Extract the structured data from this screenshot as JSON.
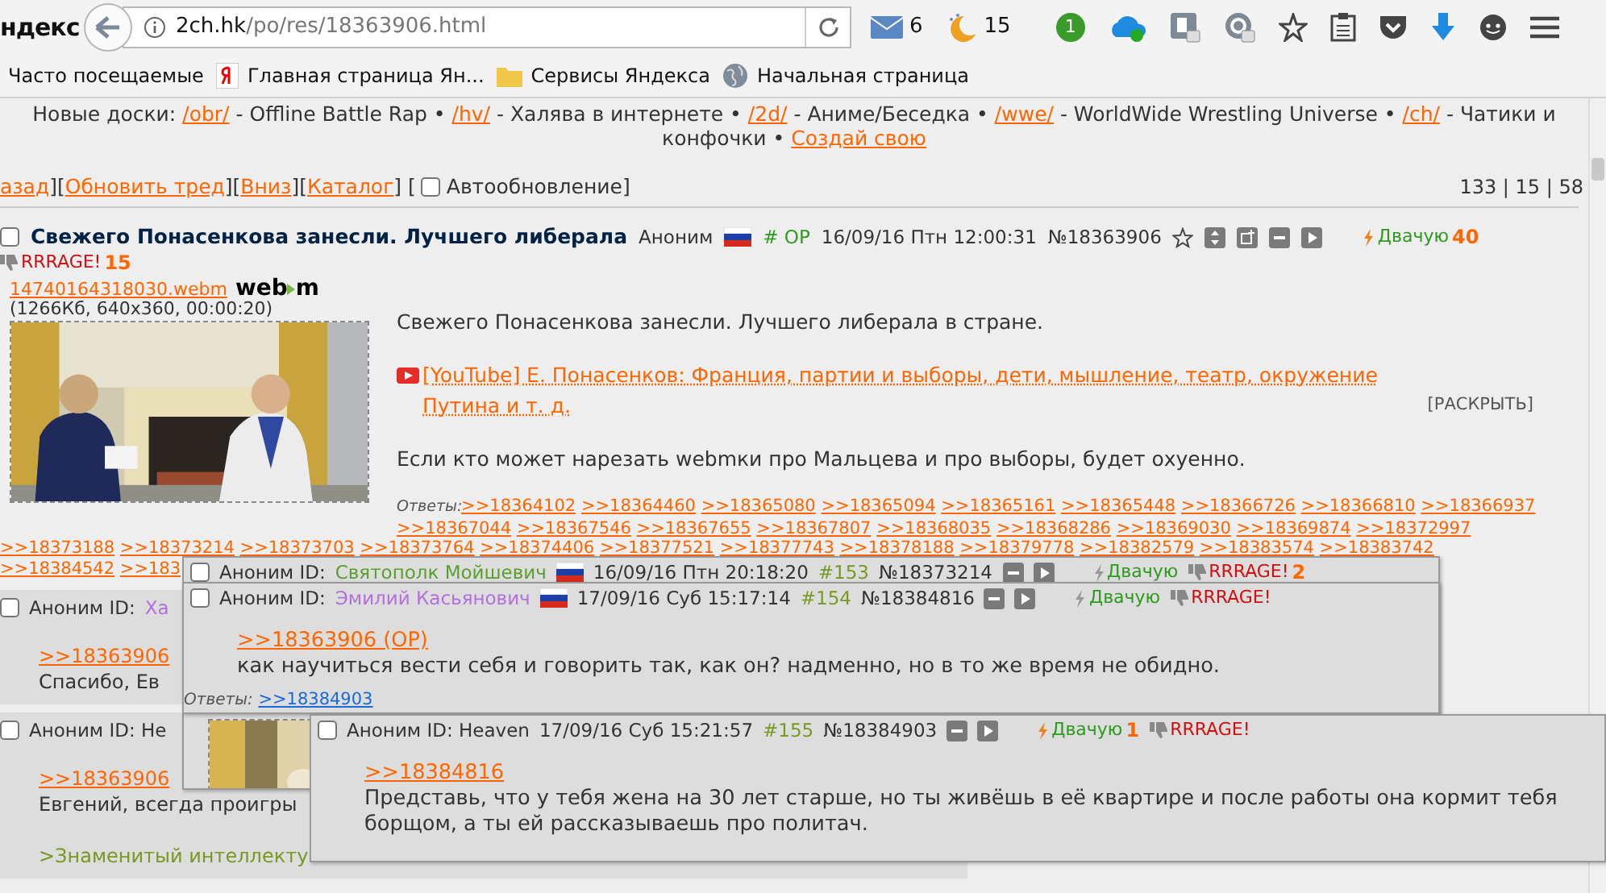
{
  "browser": {
    "logo": "ндекс",
    "url_host": "2ch.hk",
    "url_path": "/po/res/18363906.html",
    "toolbar": [
      {
        "kind": "mail",
        "count": "6"
      },
      {
        "kind": "moon",
        "count": "15"
      },
      {
        "kind": "badge",
        "count": "1"
      },
      {
        "kind": "cloud"
      },
      {
        "kind": "b-ext"
      },
      {
        "kind": "g-ext"
      },
      {
        "kind": "star"
      },
      {
        "kind": "clipboard"
      },
      {
        "kind": "pocket"
      },
      {
        "kind": "download"
      },
      {
        "kind": "chat"
      },
      {
        "kind": "menu"
      }
    ],
    "bookmarks": [
      {
        "kind": "plain",
        "label": "Часто посещаемые"
      },
      {
        "kind": "yandex",
        "label": "Главная страница Ян..."
      },
      {
        "kind": "folder",
        "label": "Сервисы Яндекса"
      },
      {
        "kind": "globe",
        "label": "Начальная страница"
      }
    ]
  },
  "board_nav": [
    {
      "kind": "text",
      "text": "Новые доски:"
    },
    {
      "kind": "link",
      "text": "/obr/"
    },
    {
      "kind": "text",
      "text": "- Offline Battle Rap •"
    },
    {
      "kind": "link",
      "text": "/hv/"
    },
    {
      "kind": "text",
      "text": "- Халява в интернете •"
    },
    {
      "kind": "link",
      "text": "/2d/"
    },
    {
      "kind": "text",
      "text": "- Аниме/Беседка •"
    },
    {
      "kind": "link",
      "text": "/wwe/"
    },
    {
      "kind": "text",
      "text": "- WorldWide Wrestling Universe •"
    },
    {
      "kind": "link",
      "text": "/ch/"
    },
    {
      "kind": "text",
      "text": "- Чатики и конфочки •"
    },
    {
      "kind": "link",
      "text": "Создай свою"
    }
  ],
  "thread_nav": [
    {
      "kind": "link",
      "text": "азад"
    },
    {
      "kind": "text",
      "text": "]["
    },
    {
      "kind": "link",
      "text": "Обновить тред"
    },
    {
      "kind": "text",
      "text": "]["
    },
    {
      "kind": "link",
      "text": "Вниз"
    },
    {
      "kind": "text",
      "text": "]["
    },
    {
      "kind": "link",
      "text": "Каталог"
    },
    {
      "kind": "text",
      "text": "] ["
    },
    {
      "kind": "checkbox",
      "text": "Автообновление",
      "checked": false
    },
    {
      "kind": "text",
      "text": "]"
    }
  ],
  "counts": "133 | 15 | 58",
  "op": {
    "checked": false,
    "subject": "Свежего Понасенкова занесли. Лучшего либерала",
    "name": "Аноним",
    "flag": {
      "kind": "ru"
    },
    "op_mark": "# OP",
    "date": "16/09/16 Птн 12:00:31",
    "number": "№18363906",
    "buttons": [
      {
        "kind": "star"
      },
      {
        "kind": "updown"
      },
      {
        "kind": "window"
      },
      {
        "kind": "hide"
      },
      {
        "kind": "play"
      }
    ],
    "like": {
      "label": "Двачую",
      "count": "40"
    },
    "dislike": {
      "label": "RRRAGE!",
      "count": "15"
    },
    "file": {
      "name": "14740164318030.webm",
      "logo": [
        "web",
        "m"
      ],
      "info": "(1266Кб, 640x360, 00:00:20)"
    },
    "body": [
      {
        "kind": "text",
        "text": "Свежего Понасенкова занесли. Лучшего либерала в стране."
      },
      {
        "kind": "video",
        "text": "[YouTube] Е. Понасенков: Франция, партии и выборы, дети, мышление, театр, окружение Путина и т. д.",
        "expand": "[РАСКРЫТЬ]"
      },
      {
        "kind": "text",
        "text": "Если кто может нарезать webmки про Мальцева и про выборы, будет охуенно."
      }
    ],
    "replies_label": "Ответы:",
    "replies": [
      ">>18364102",
      ">>18364460",
      ">>18365080",
      ">>18365094",
      ">>18365161",
      ">>18365448",
      ">>18366726",
      ">>18366810",
      ">>18366937",
      ">>18367044",
      ">>18367546",
      ">>18367655",
      ">>18367807",
      ">>18368035",
      ">>18368286",
      ">>18369030",
      ">>18369874",
      ">>18372997",
      ">>18373188",
      ">>18373214",
      ">>18373703",
      ">>18373764",
      ">>18374406",
      ">>18377521",
      ">>18377743",
      ">>18378188",
      ">>18379778",
      ">>18382579",
      ">>18383574",
      ">>18383742",
      ">>18384542",
      ">>183"
    ]
  },
  "posts": [
    {
      "checked": false,
      "name": "Аноним ID:",
      "id": {
        "text": "Ха",
        "color": "#b36fe0"
      },
      "body": [
        {
          "kind": "link",
          "text": ">>18363906"
        },
        {
          "kind": "text",
          "text": "Спасибо, Ев"
        }
      ]
    },
    {
      "checked": false,
      "name": "Аноним ID: Не",
      "body": [
        {
          "kind": "link",
          "text": ">>18363906"
        },
        {
          "kind": "text",
          "text": "Евгений, всегда проигры"
        },
        {
          "kind": "quote",
          "text": ">Знаменитый интеллекту"
        }
      ]
    }
  ],
  "popups": [
    {
      "checked": false,
      "name": "Аноним ID:",
      "id": {
        "text": "Святополк Мойшевич",
        "color": "#5aa02c"
      },
      "flag": {
        "kind": "ru"
      },
      "date": "16/09/16 Птн 20:18:20",
      "post_no": "#153",
      "number": "№18373214",
      "buttons": [
        {
          "kind": "hide"
        },
        {
          "kind": "play"
        }
      ],
      "like": {
        "label": "Двачую"
      },
      "dislike": {
        "label": "RRRAGE!",
        "count": "2"
      },
      "file": {
        "kind": "picture"
      }
    },
    {
      "checked": false,
      "name": "Аноним ID:",
      "id": {
        "text": "Эмилий Касьянович",
        "color": "#b36fe0"
      },
      "flag": {
        "kind": "ru"
      },
      "date": "17/09/16 Суб 15:17:14",
      "post_no": "#154",
      "number": "№18384816",
      "buttons": [
        {
          "kind": "hide"
        },
        {
          "kind": "play"
        }
      ],
      "like": {
        "label": "Двачую"
      },
      "dislike": {
        "label": "RRRAGE!"
      },
      "body": [
        {
          "kind": "link",
          "text": ">>18363906 (OP)"
        },
        {
          "kind": "text",
          "text": "как научиться вести себя и говорить так, как он? надменно, но в то же время не обидно."
        }
      ],
      "replies_label": "Ответы:",
      "replies": [
        {
          "text": ">>18384903",
          "hovered": true
        }
      ]
    },
    {
      "checked": false,
      "name": "Аноним ID: Heaven",
      "date": "17/09/16 Суб 15:21:57",
      "post_no": "#155",
      "number": "№18384903",
      "buttons": [
        {
          "kind": "hide"
        },
        {
          "kind": "play"
        }
      ],
      "like": {
        "label": "Двачую",
        "count": "1"
      },
      "dislike": {
        "label": "RRRAGE!"
      },
      "body": [
        {
          "kind": "link",
          "text": ">>18384816"
        },
        {
          "kind": "text",
          "text": "Представь, что у тебя жена на 30 лет старше, но ты живёшь в её квартире и после работы она кормит тебя борщом, а ты ей рассказываешь про политач."
        }
      ]
    }
  ]
}
